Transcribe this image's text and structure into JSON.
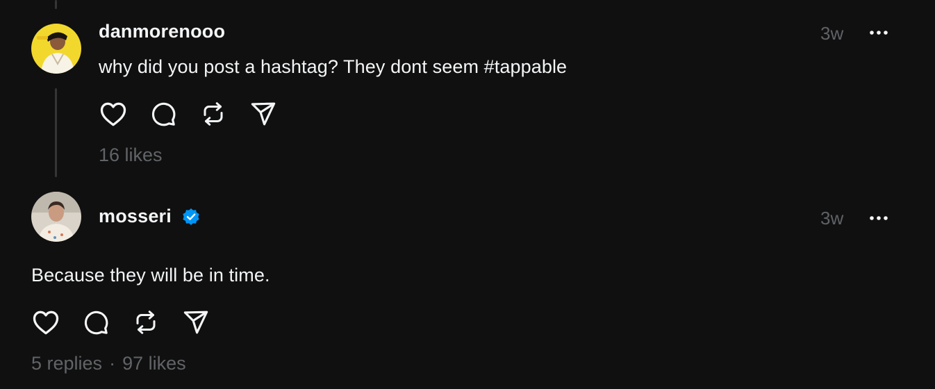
{
  "comments": [
    {
      "username": "danmorenooo",
      "timestamp": "3w",
      "text": "why did you post a hashtag? They dont seem #tappable",
      "likes": "16 likes",
      "verified": false,
      "avatar_bg": "#f2d82c"
    },
    {
      "username": "mosseri",
      "timestamp": "3w",
      "text": "Because they will be in time.",
      "replies": "5 replies",
      "separator": "·",
      "likes": "97 likes",
      "verified": true,
      "avatar_bg": "#d9d3c9"
    }
  ],
  "actions": [
    "heart-icon",
    "comment-icon",
    "repost-icon",
    "share-icon"
  ],
  "colors": {
    "background": "#101010",
    "text": "#f3f5f7",
    "muted": "#616467",
    "verified": "#0095f6",
    "thread_line": "#333638"
  }
}
